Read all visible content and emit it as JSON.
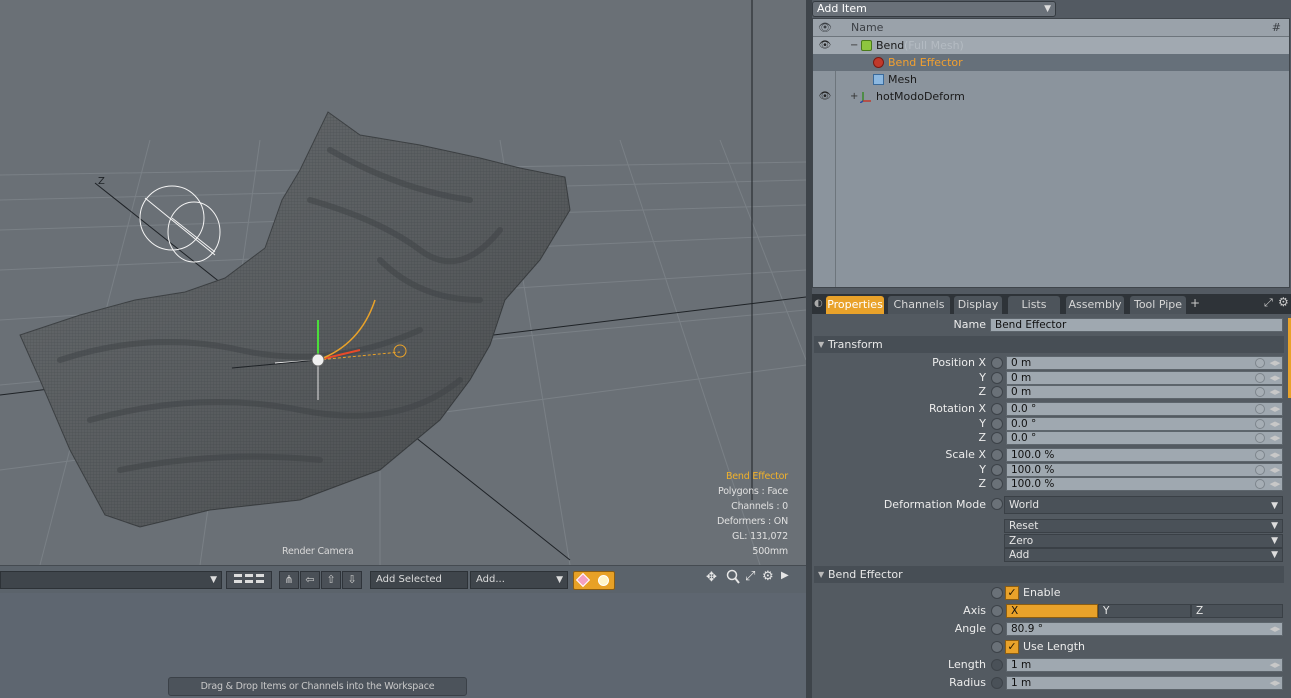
{
  "viewport": {
    "hud": {
      "selected_item": "Bend Effector",
      "polygons": "Polygons : Face",
      "channels": "Channels : 0",
      "deformers": "Deformers : ON",
      "gl": "GL: 131,072",
      "scale": "500mm"
    },
    "camera_label": "Render Camera",
    "axis_label": "Z"
  },
  "timeline_toolbar": {
    "dropdown_value": "",
    "add_selected_label": "Add Selected",
    "add_label": "Add...",
    "icons": [
      "grid-layout-icon",
      "tree-icon",
      "arrow-left-icon",
      "arrow-up-icon",
      "arrow-down-icon",
      "keyframe-diamond-icon",
      "record-dot-icon",
      "move-icon",
      "zoom-icon",
      "maximize-icon",
      "gear-icon",
      "play-icon"
    ]
  },
  "workspace": {
    "drop_hint": "Drag & Drop Items or Channels into the Workspace"
  },
  "item_list": {
    "add_item_label": "Add Item",
    "columns": {
      "name": "Name",
      "count": "#"
    },
    "items": [
      {
        "label": "Bend",
        "sub": "(Full Mesh)",
        "icon": "mesh-group-icon",
        "expander": "−",
        "visible": true
      },
      {
        "label": "Bend Effector",
        "sub": "",
        "icon": "bend-effector-icon",
        "expander": "",
        "visible": false,
        "selected": true
      },
      {
        "label": "Mesh",
        "sub": "",
        "icon": "mesh-cube-icon",
        "expander": "",
        "visible": false
      },
      {
        "label": "hotModoDeform",
        "sub": "",
        "icon": "locator-axis-icon",
        "expander": "+",
        "visible": true
      }
    ]
  },
  "properties": {
    "tabs": [
      "Properties",
      "Channels",
      "Display",
      "Lists",
      "Assembly",
      "Tool Pipe"
    ],
    "add_tab": "+",
    "name_label": "Name",
    "name_value": "Bend Effector",
    "transform": {
      "header": "Transform",
      "position_label": "Position X",
      "rotation_label": "Rotation X",
      "scale_label": "Scale X",
      "y_label": "Y",
      "z_label": "Z",
      "position": [
        "0 m",
        "0 m",
        "0 m"
      ],
      "rotation": [
        "0.0 °",
        "0.0 °",
        "0.0 °"
      ],
      "scale": [
        "100.0 %",
        "100.0 %",
        "100.0 %"
      ],
      "deformation_mode_label": "Deformation Mode",
      "deformation_mode_value": "World",
      "reset": "Reset",
      "zero": "Zero",
      "add": "Add"
    },
    "bend_effector": {
      "header": "Bend Effector",
      "enable_label": "Enable",
      "axis_label": "Axis",
      "axis_options": [
        "X",
        "Y",
        "Z"
      ],
      "axis_selected": "X",
      "angle_label": "Angle",
      "angle_value": "80.9 °",
      "use_length_label": "Use Length",
      "length_label": "Length",
      "length_value": "1 m",
      "radius_label": "Radius",
      "radius_value": "1 m"
    }
  },
  "colors": {
    "accent": "#e9a22a",
    "selected_text": "#f2b22a"
  }
}
